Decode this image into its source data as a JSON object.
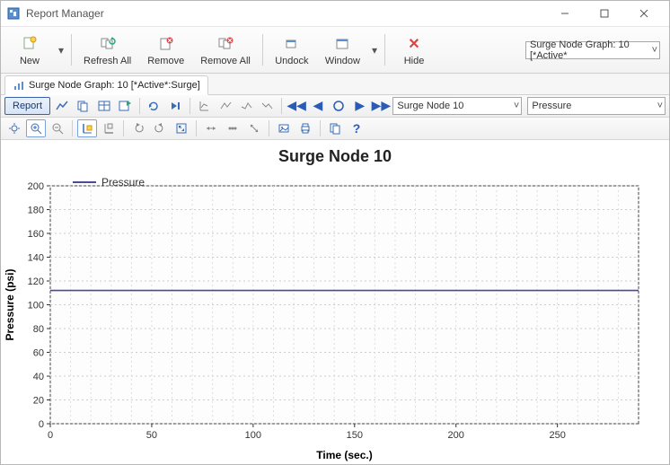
{
  "titlebar": {
    "title": "Report Manager"
  },
  "toolbar": {
    "new": "New",
    "refresh": "Refresh All",
    "remove": "Remove",
    "removeAll": "Remove All",
    "undock": "Undock",
    "window": "Window",
    "hide": "Hide"
  },
  "top_combo": {
    "value": "Surge Node Graph: 10 [*Active*"
  },
  "tab": {
    "label": "Surge Node Graph: 10 [*Active*:Surge]"
  },
  "secbar": {
    "report": "Report",
    "node_combo": "Surge Node 10",
    "param_combo": "Pressure"
  },
  "chart_data": {
    "type": "line",
    "title": "Surge Node 10",
    "xlabel": "Time (sec.)",
    "ylabel": "Pressure (psi)",
    "xlim": [
      0,
      290
    ],
    "ylim": [
      0,
      200
    ],
    "xticks": [
      0,
      50,
      100,
      150,
      200,
      250
    ],
    "yticks": [
      0,
      20,
      40,
      60,
      80,
      100,
      120,
      140,
      160,
      180,
      200
    ],
    "series": [
      {
        "name": "Pressure",
        "color": "#4a4a9a",
        "values": [
          [
            0,
            112
          ],
          [
            290,
            112
          ]
        ]
      }
    ]
  },
  "help_char": "?"
}
